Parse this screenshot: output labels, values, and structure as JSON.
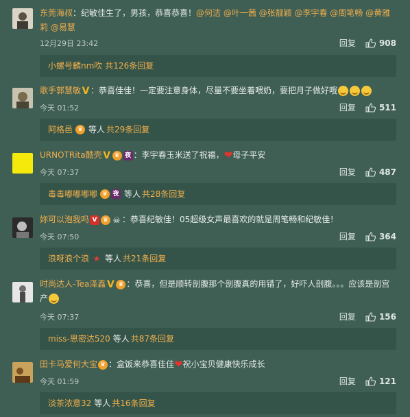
{
  "reply_label": "回复",
  "comments": [
    {
      "username": "东莞海叔",
      "text": "：纪敏佳生了，男孩，恭喜恭喜！",
      "mentions": "@何洁 @叶一茜 @张靓颖 @李宇春 @周笔畅 @黄雅莉 @易慧",
      "time": "12月29日 23:42",
      "likes": "908",
      "reply_user": "小螺号麟nm吹",
      "reply_etc": "",
      "reply_total": "共126条回复"
    },
    {
      "username": "歌手郭慧敏",
      "text": "：恭喜佳佳！一定要注意身体，尽量不要坐着喂奶，要把月子做好哦",
      "time": "今天 01:52",
      "likes": "511",
      "reply_user": "阿格邑",
      "reply_etc": "等人",
      "reply_total": "共29条回复"
    },
    {
      "username": "URNOTRita酷壳",
      "text": "：李宇春玉米送了祝福，",
      "text2": "母子平安",
      "time": "今天 07:37",
      "likes": "487",
      "reply_user": "毒毒嘟嘟嘟嘟",
      "reply_etc": "等人",
      "reply_total": "共28条回复"
    },
    {
      "username": "妳可以泡我吗",
      "text": "：恭喜纪敏佳！05超级女声最喜欢的就是周笔畅和纪敏佳！",
      "time": "今天 07:50",
      "likes": "364",
      "reply_user": "浪呀浪个浪",
      "reply_etc": "等人",
      "reply_total": "共21条回复"
    },
    {
      "username": "时尚达人-Tea泽鑫",
      "text": "：恭喜，但是顺转剖腹那个剖腹真的用错了，好吓人剖腹。。。应该是剖宫产",
      "time": "今天 07:37",
      "likes": "156",
      "reply_user": "miss-思密达520",
      "reply_etc": "等人",
      "reply_total": "共87条回复"
    },
    {
      "username": "田卡马爱何大宝",
      "text": "：盒饭来恭喜佳佳",
      "text2": "祝小宝贝健康快乐成长",
      "time": "今天 01:59",
      "likes": "121",
      "reply_user": "淡茶浓意32",
      "reply_etc": "等人",
      "reply_total": "共16条回复"
    }
  ],
  "colors": {
    "background": "#3f5f55",
    "reply_box": "#34544a",
    "accent": "#f0ae4b"
  },
  "icons": [
    "thumbs-up-icon",
    "verified-v-icon",
    "crown-badge-icon",
    "night-badge-icon",
    "star-badge-icon",
    "heart-emoji-icon",
    "grin-emoji-icon"
  ]
}
